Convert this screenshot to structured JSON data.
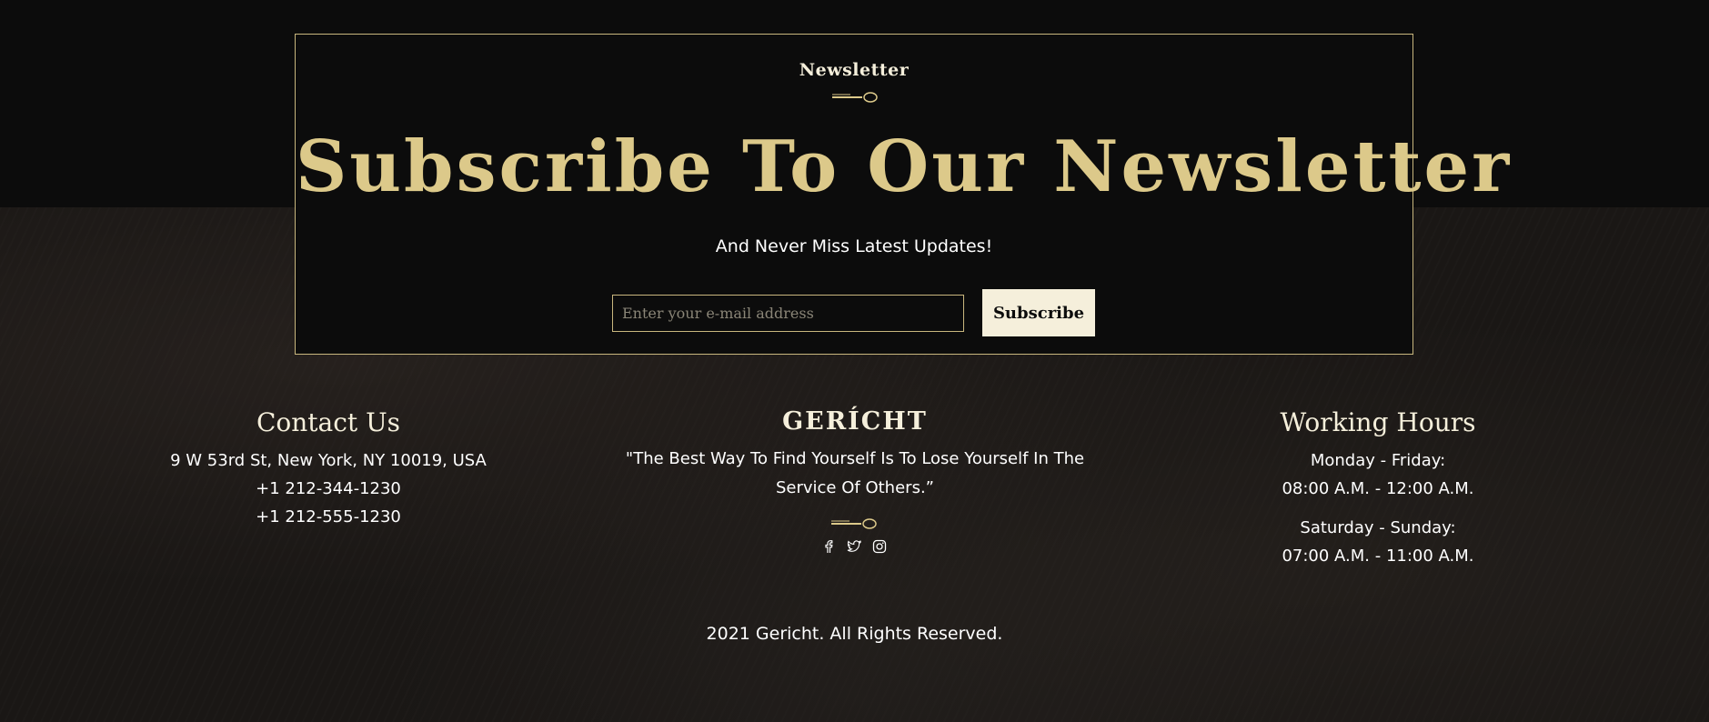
{
  "newsletter": {
    "subtitle": "Newsletter",
    "heading": "Subscribe To Our Newsletter",
    "tagline": "And Never Miss Latest Updates!",
    "email_placeholder": "Enter your e-mail address",
    "email_value": "",
    "subscribe_label": "Subscribe"
  },
  "footer": {
    "contact": {
      "title": "Contact Us",
      "lines": [
        "9 W 53rd St, New York, NY 10019, USA",
        "+1 212-344-1230",
        "+1 212-555-1230"
      ]
    },
    "brand": {
      "name": "GERÍCHT",
      "quote": "\"The Best Way To Find Yourself Is To Lose Yourself In The Service Of Others.”",
      "socials": [
        "facebook-icon",
        "twitter-icon",
        "instagram-icon"
      ]
    },
    "hours": {
      "title": "Working Hours",
      "weekday_label": "Monday - Friday:",
      "weekday_time": "08:00 A.M. - 12:00 A.M.",
      "weekend_label": "Saturday - Sunday:",
      "weekend_time": "07:00 A.M. - 11:00 A.M."
    },
    "copyright": "2021 Gericht. All Rights Reserved."
  },
  "colors": {
    "gold": "#dcc98a",
    "cream": "#f5efdb",
    "background": "#0c0c0c",
    "border": "#c9b77e"
  }
}
